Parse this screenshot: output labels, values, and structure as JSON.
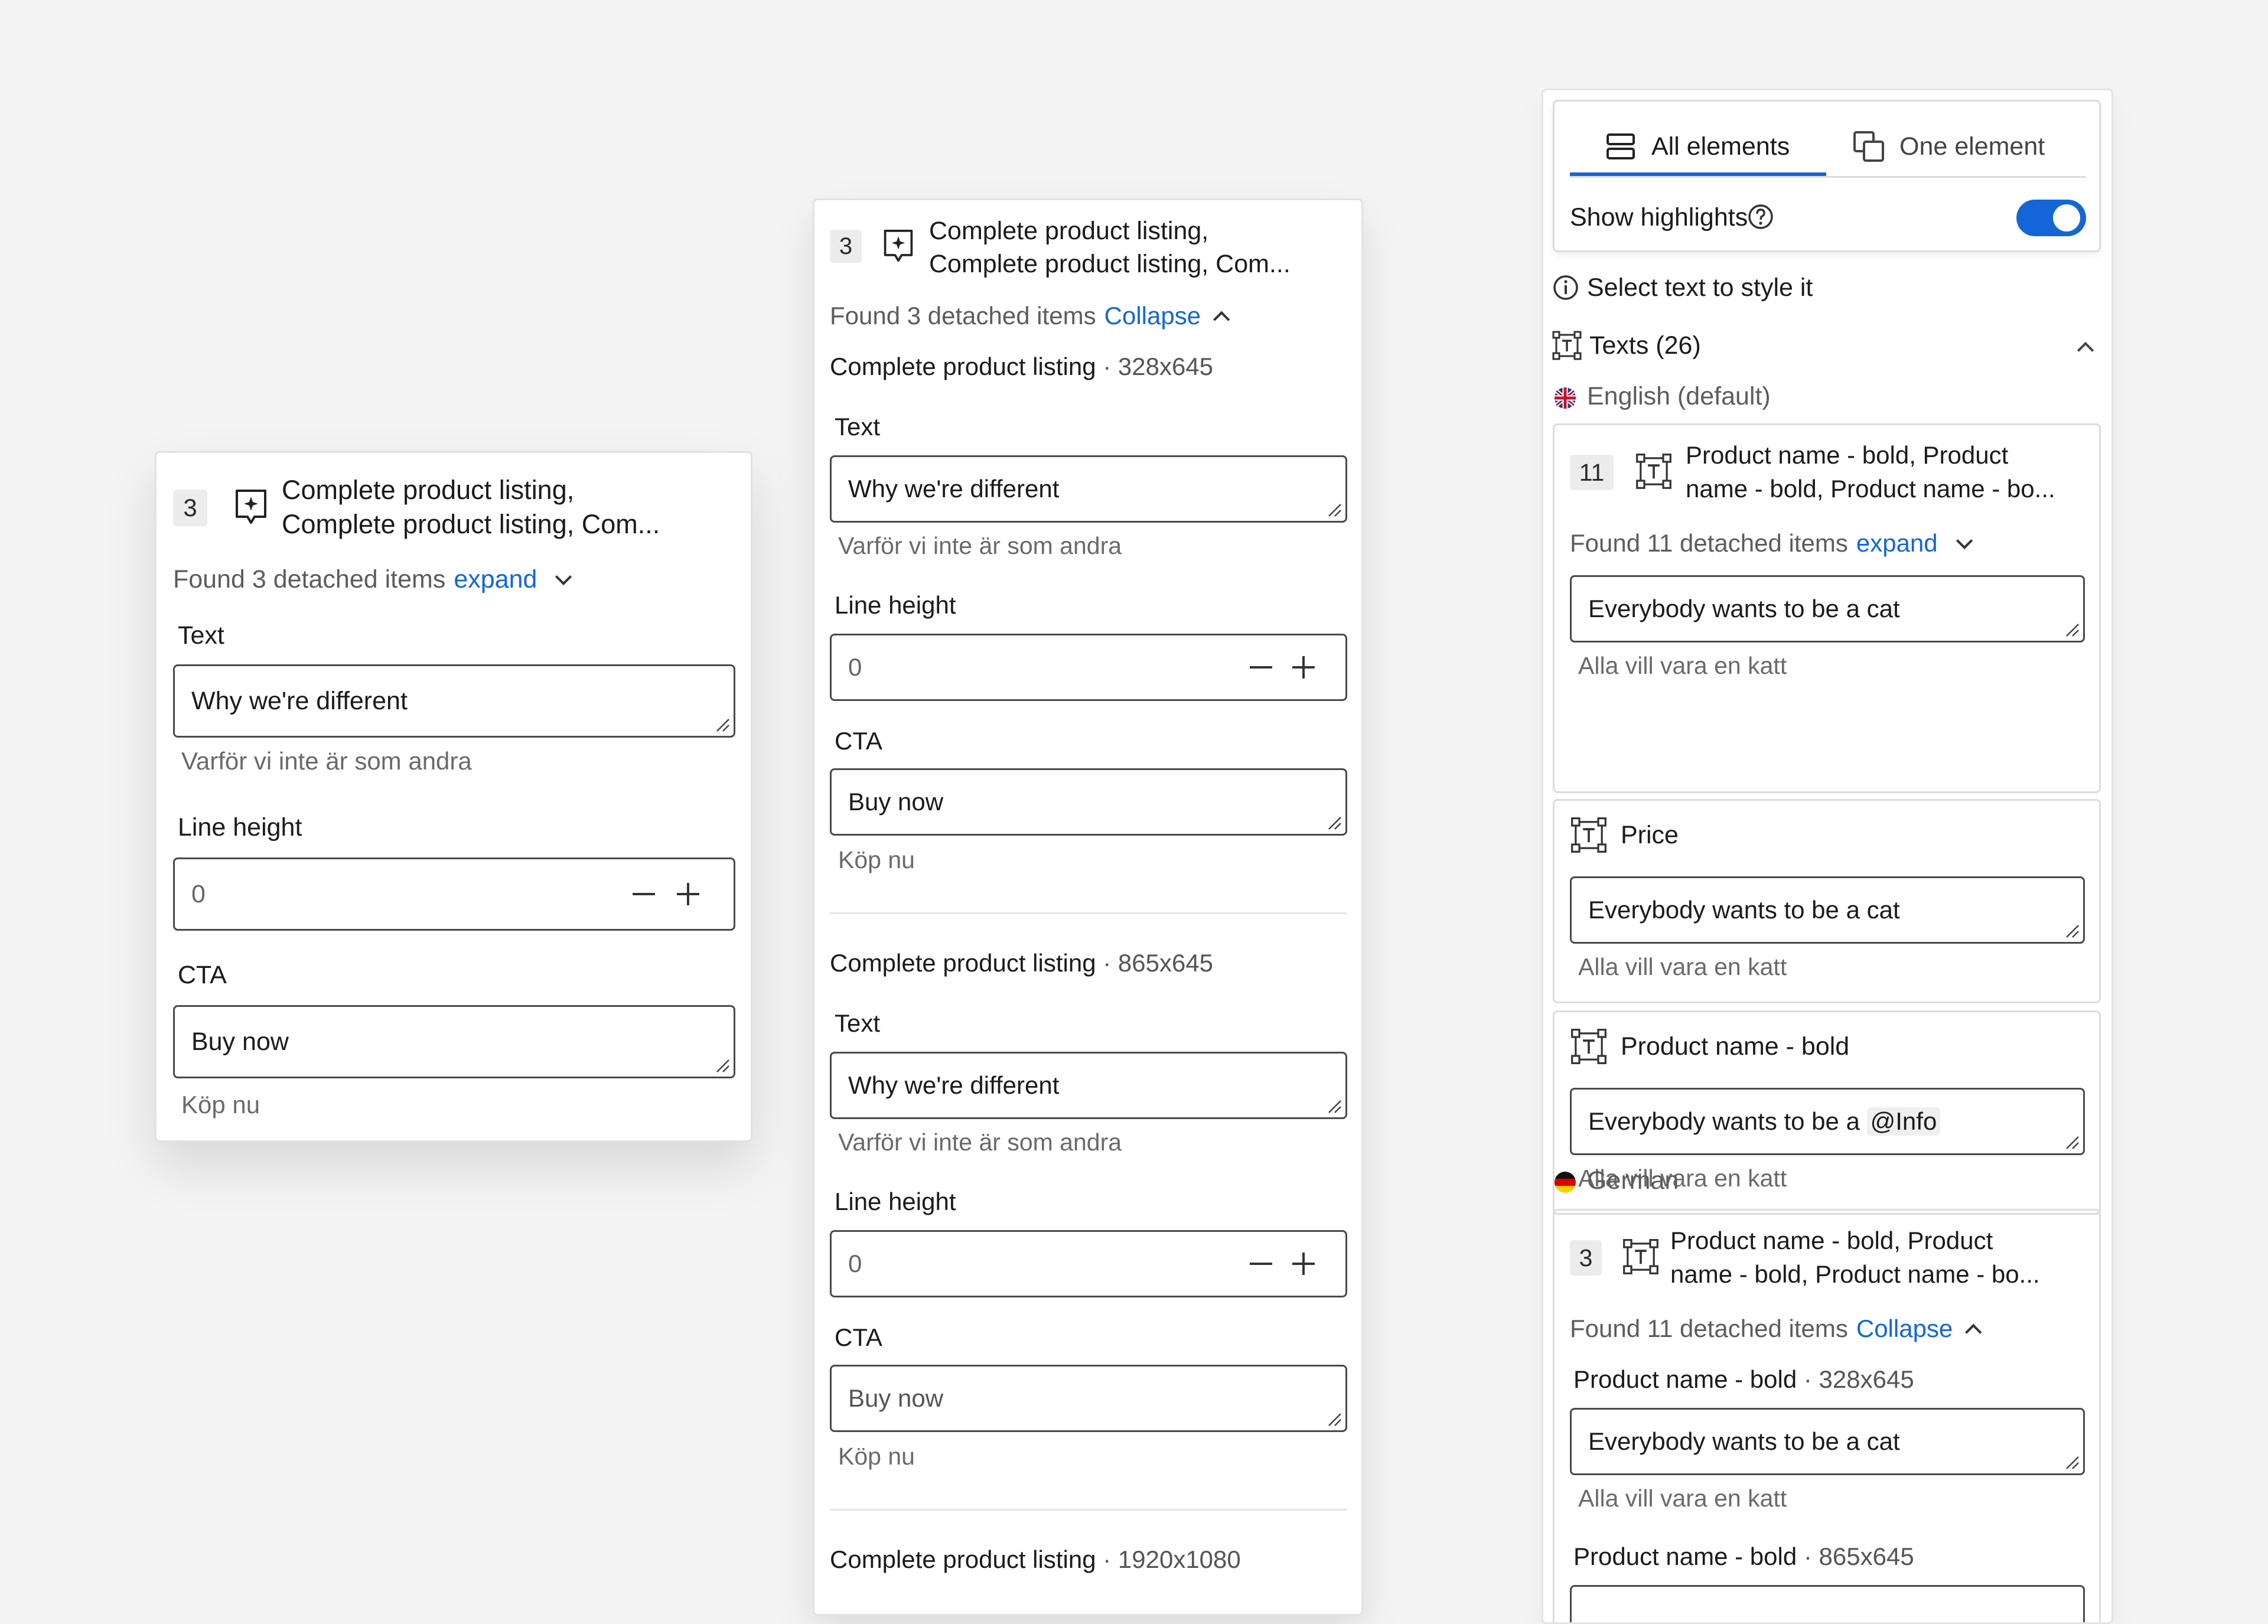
{
  "panel_left": {
    "count": "3",
    "title_line1": "Complete product listing,",
    "title_line2": "Complete product listing, Com...",
    "found_text": "Found 3 detached items",
    "toggle_link": "expand",
    "text_label": "Text",
    "text_value": "Why we're different",
    "text_translation": "Varför vi inte är som andra",
    "line_height_label": "Line height",
    "line_height_value": "0",
    "cta_label": "CTA",
    "cta_value": "Buy now",
    "cta_translation": "Köp nu"
  },
  "panel_middle": {
    "count": "3",
    "title_line1": "Complete product listing,",
    "title_line2": "Complete product listing, Com...",
    "found_text": "Found 3 detached items",
    "toggle_link": "Collapse",
    "sections": [
      {
        "name": "Complete product listing",
        "size": "· 328x645",
        "text_label": "Text",
        "text_value": "Why we're different",
        "text_translation": "Varför vi inte är som andra",
        "line_height_label": "Line height",
        "line_height_value": "0",
        "cta_label": "CTA",
        "cta_value": "Buy now",
        "cta_translation": "Köp nu"
      },
      {
        "name": "Complete product listing",
        "size": "· 865x645",
        "text_label": "Text",
        "text_value": "Why we're different",
        "text_translation": "Varför vi inte är som andra",
        "line_height_label": "Line height",
        "line_height_value": "0",
        "cta_label": "CTA",
        "cta_placeholder": "Buy now",
        "cta_translation": "Köp nu"
      },
      {
        "name": "Complete product listing",
        "size": "· 1920x1080"
      }
    ]
  },
  "panel_right": {
    "tabs": [
      {
        "label": "All elements",
        "active": true
      },
      {
        "label": "One element",
        "active": false
      }
    ],
    "show_highlights_label": "Show highlights",
    "show_highlights_on": true,
    "hint": "Select text to style it",
    "texts_header": "Texts (26)",
    "english_label": "English (default)",
    "english_cards": [
      {
        "count": "11",
        "title_line1": "Product name - bold, Product",
        "title_line2": "name - bold, Product name - bo...",
        "found_text": "Found 11 detached items",
        "toggle_link": "expand",
        "value": "Everybody wants to be a cat",
        "translation": "Alla vill vara en katt"
      },
      {
        "title": "Price",
        "value": "Everybody wants to be a cat",
        "translation": "Alla vill vara en katt"
      },
      {
        "title": "Product name - bold",
        "value_prefix": "Everybody wants to be a",
        "value_mention": "@Info",
        "translation": "Alla vill vara en katt"
      }
    ],
    "german_label": "German",
    "german_card": {
      "count": "3",
      "title_line1": "Product name - bold, Product",
      "title_line2": "name - bold, Product name - bo...",
      "found_text": "Found 11 detached items",
      "toggle_link": "Collapse",
      "item1_name": "Product name - bold",
      "item1_size": "· 328x645",
      "item1_value": "Everybody wants to be a cat",
      "item1_translation": "Alla vill vara en katt",
      "item2_name": "Product name - bold",
      "item2_size": "· 865x645"
    },
    "accent_color": "#1466d8"
  }
}
